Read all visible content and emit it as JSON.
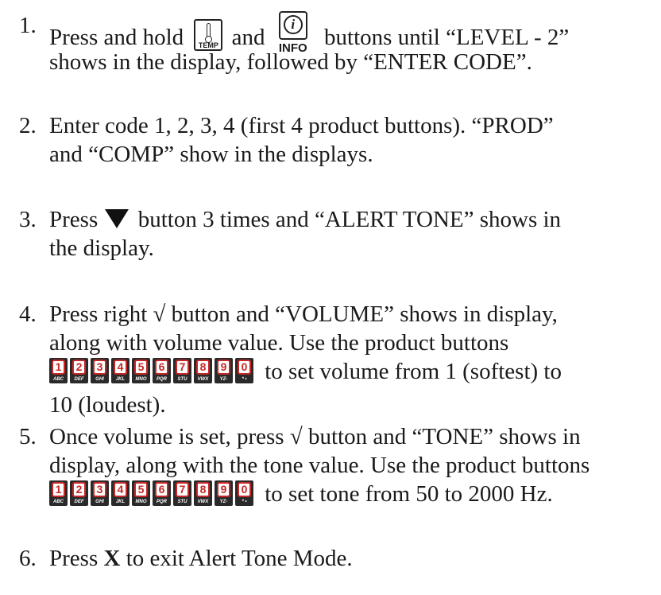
{
  "steps": [
    {
      "number": "1.",
      "part_a": "Press and hold",
      "part_b": "and",
      "part_c": "buttons until “LEVEL - 2”",
      "line2": "shows in the display, followed by “ENTER CODE”."
    },
    {
      "number": "2.",
      "line1": "Enter code 1, 2, 3, 4 (first 4 product buttons).  “PROD”",
      "line2": "and “COMP” show in the displays."
    },
    {
      "number": "3.",
      "part_a": "Press",
      "part_b": "button 3 times and “ALERT TONE” shows in",
      "line2": "the display."
    },
    {
      "number": "4.",
      "line1": "Press right √ button and “VOLUME” shows in display,",
      "line2": "along with volume value.  Use the product buttons",
      "line3_after": "to set volume from 1 (softest) to",
      "line4": "10 (loudest)."
    },
    {
      "number": "5.",
      "line1": "Once volume is set, press √ button and “TONE” shows in",
      "line2": "display, along with the tone value.  Use the product buttons",
      "line3_after": "to set tone from 50 to 2000 Hz."
    },
    {
      "number": "6.",
      "part_a": "Press",
      "bold": "X",
      "part_b": "to exit Alert Tone Mode."
    }
  ],
  "icons": {
    "temp_label": "TEMP",
    "info_label": "INFO",
    "info_glyph": "i"
  },
  "keypad": [
    {
      "digit": "1",
      "letters": "ABC"
    },
    {
      "digit": "2",
      "letters": "DEF"
    },
    {
      "digit": "3",
      "letters": "GHI"
    },
    {
      "digit": "4",
      "letters": "JKL"
    },
    {
      "digit": "5",
      "letters": "MNO"
    },
    {
      "digit": "6",
      "letters": "PQR"
    },
    {
      "digit": "7",
      "letters": "STU"
    },
    {
      "digit": "8",
      "letters": "VWX"
    },
    {
      "digit": "9",
      "letters": "YZ-"
    },
    {
      "digit": "0",
      "letters": "* •"
    }
  ]
}
